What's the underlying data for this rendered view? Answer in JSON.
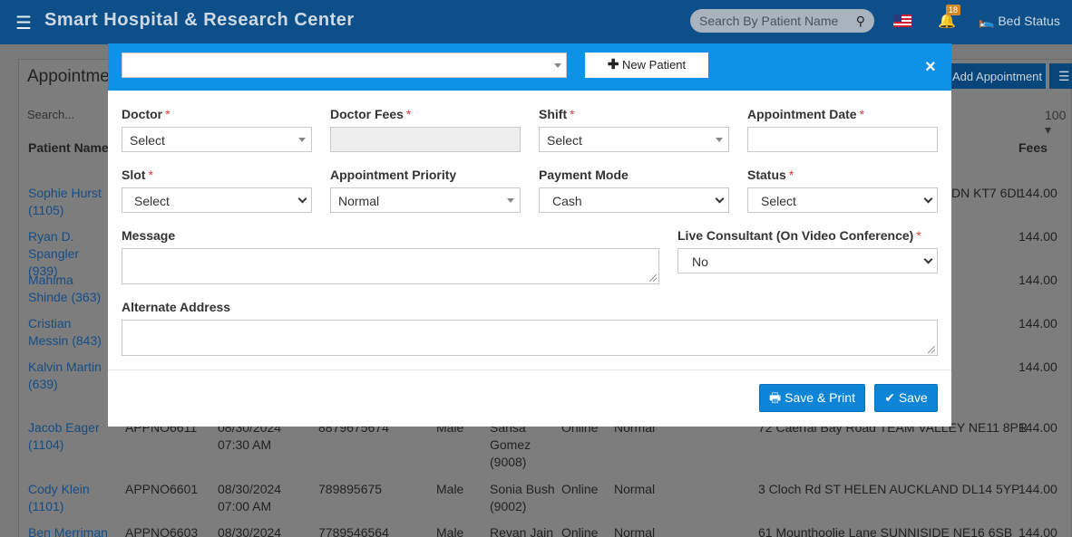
{
  "app": {
    "title": "Smart Hospital & Research Center",
    "search_placeholder": "Search By Patient Name",
    "notification_count": "18",
    "bed_status_label": "Bed Status"
  },
  "background_page": {
    "panel_title": "Appointme",
    "add_appointment_label": "Add Appointment",
    "search_placeholder": "Search...",
    "page_size": "100",
    "columns": [
      "Patient Name",
      "Fees"
    ],
    "rows": [
      {
        "patient": "Sophie Hurst (1105)",
        "address": "DN KT7 6DL",
        "fees": "144.00"
      },
      {
        "patient": "Ryan D. Spangler (939)",
        "fees": "144.00"
      },
      {
        "patient": "Mahima Shinde (363)",
        "fees": "144.00"
      },
      {
        "patient": "Cristian Messin (843)",
        "fees": "144.00"
      },
      {
        "patient": "Kalvin Martin (639)",
        "fees": "144.00"
      },
      {
        "patient": "Jacob Eager (1104)",
        "appt_no": "APPNO6611",
        "date": "08/30/2024 07:30 AM",
        "phone": "8879675674",
        "gender": "Male",
        "doctor": "Sansa Gomez (9008)",
        "source": "Online",
        "priority": "Normal",
        "address": "72 Caerfai Bay Road TEAM VALLEY NE11 8PR",
        "fees": "144.00"
      },
      {
        "patient": "Cody Klein (1101)",
        "appt_no": "APPNO6601",
        "date": "08/30/2024 07:00 AM",
        "phone": "789895675",
        "gender": "Male",
        "doctor": "Sonia Bush (9002)",
        "source": "Online",
        "priority": "Normal",
        "address": "3 Cloch Rd ST HELEN AUCKLAND DL14 5YP",
        "fees": "144.00"
      },
      {
        "patient": "Ben Merriman",
        "appt_no": "APPNO6603",
        "date": "08/30/2024",
        "phone": "7789546564",
        "gender": "Male",
        "doctor": "Reyan Jain",
        "source": "Online",
        "priority": "Normal",
        "address": "61 Mounthoolie Lane SUNNISIDE NE16 6SB",
        "fees": "144.00"
      }
    ]
  },
  "modal": {
    "patient_select_value": "",
    "new_patient_label": "New Patient",
    "close_label": "×",
    "fields": {
      "doctor": {
        "label": "Doctor",
        "value": "Select"
      },
      "doctor_fees": {
        "label": "Doctor Fees",
        "value": ""
      },
      "shift": {
        "label": "Shift",
        "value": "Select"
      },
      "appointment_date": {
        "label": "Appointment Date",
        "value": ""
      },
      "slot": {
        "label": "Slot",
        "value": "Select"
      },
      "appointment_priority": {
        "label": "Appointment Priority",
        "value": "Normal"
      },
      "payment_mode": {
        "label": "Payment Mode",
        "value": "Cash"
      },
      "status": {
        "label": "Status",
        "value": "Select"
      },
      "message": {
        "label": "Message",
        "value": ""
      },
      "live_consultant": {
        "label": "Live Consultant (On Video Conference)",
        "value": "No"
      },
      "alternate_address": {
        "label": "Alternate Address",
        "value": ""
      }
    },
    "save_print_label": "Save & Print",
    "save_label": "Save"
  },
  "colors": {
    "header_bg": "#0c4f89",
    "modal_header_bg": "#0d92e6",
    "primary_button": "#0d84d6",
    "required_asterisk": "#e03a3a",
    "link": "#174d85"
  }
}
